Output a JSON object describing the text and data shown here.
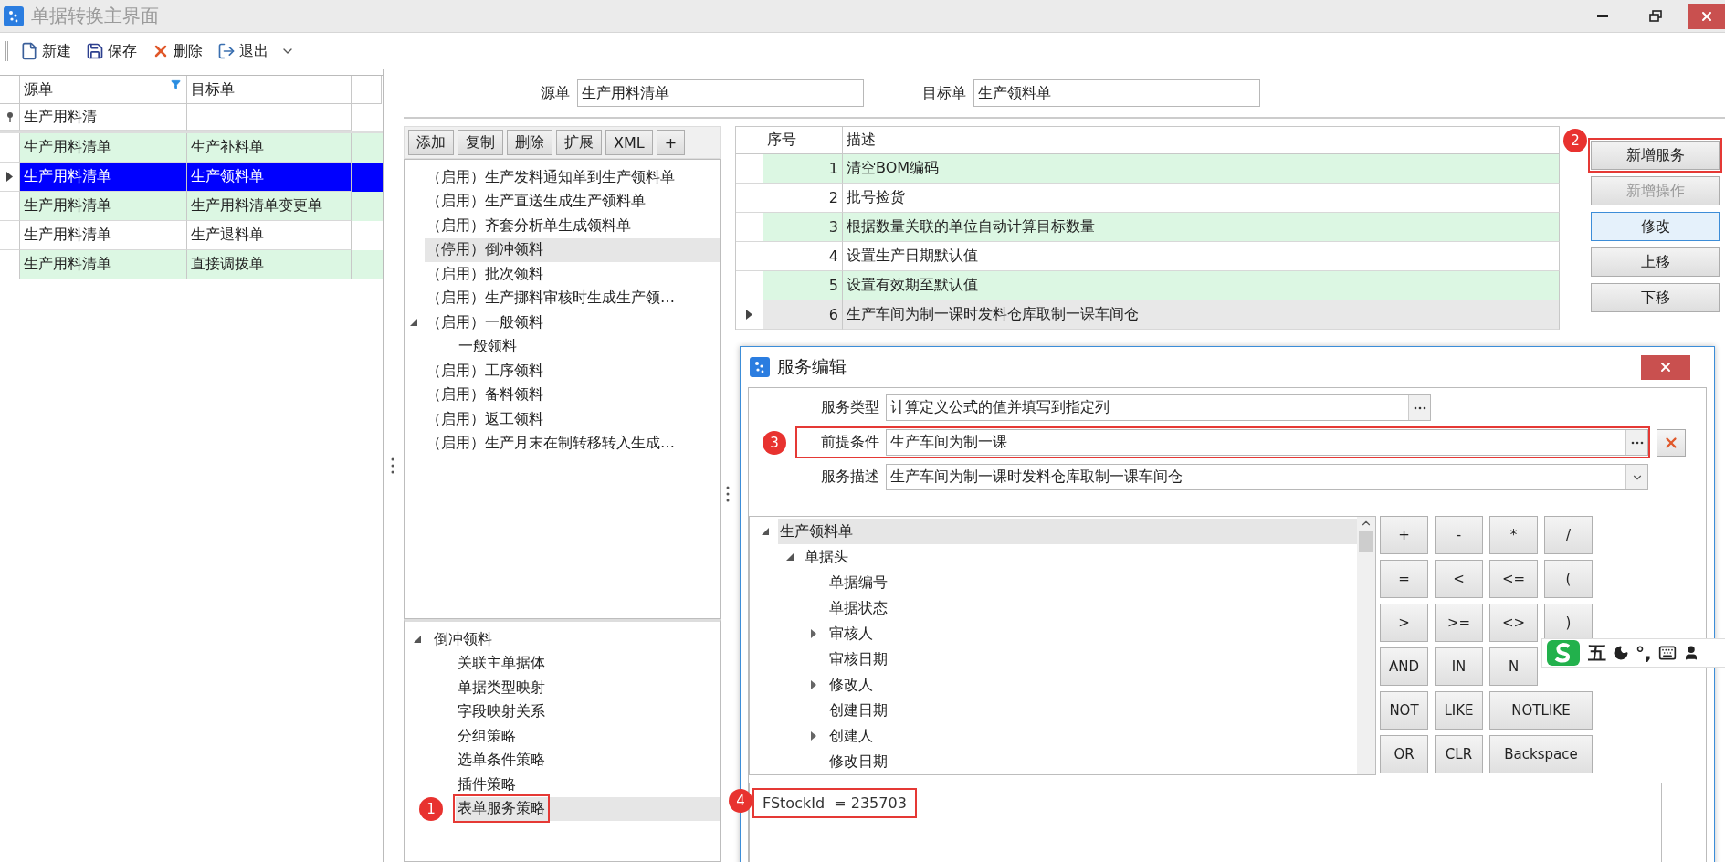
{
  "window": {
    "title": "单据转换主界面"
  },
  "toolbar": [
    {
      "label": "新建",
      "kind": "new"
    },
    {
      "label": "保存",
      "kind": "save"
    },
    {
      "label": "删除",
      "kind": "delete"
    },
    {
      "label": "退出",
      "kind": "exit"
    }
  ],
  "mapping_grid": {
    "columns": [
      "源单",
      "目标单"
    ],
    "filter": "生产用料清",
    "rows": [
      {
        "source": "生产用料清单",
        "target": "生产补料单",
        "selected": false
      },
      {
        "source": "生产用料清单",
        "target": "生产领料单",
        "selected": true
      },
      {
        "source": "生产用料清单",
        "target": "生产用料清单变更单",
        "selected": false
      },
      {
        "source": "生产用料清单",
        "target": "生产退料单",
        "selected": false
      },
      {
        "source": "生产用料清单",
        "target": "直接调拨单",
        "selected": false
      }
    ]
  },
  "header_fields": [
    {
      "label": "源单",
      "value": "生产用料清单"
    },
    {
      "label": "目标单",
      "value": "生产领料单"
    }
  ],
  "policy_buttons": [
    "添加",
    "复制",
    "删除",
    "扩展",
    "XML",
    "+"
  ],
  "policies": [
    {
      "label": "（启用）生产发料通知单到生产领料单",
      "selected": false
    },
    {
      "label": "（启用）生产直送生成生产领料单",
      "selected": false
    },
    {
      "label": "（启用）齐套分析单生成领料单",
      "selected": false
    },
    {
      "label": "（停用）倒冲领料",
      "selected": true
    },
    {
      "label": "（启用）批次领料",
      "selected": false
    },
    {
      "label": "（启用）生产挪料审核时生成生产领…",
      "selected": false
    },
    {
      "label": "（启用）一般领料",
      "selected": false,
      "expanded": true,
      "children": [
        {
          "label": "一般领料",
          "selected": false
        }
      ]
    },
    {
      "label": "（启用）工序领料",
      "selected": false
    },
    {
      "label": "（启用）备料领料",
      "selected": false
    },
    {
      "label": "（启用）返工领料",
      "selected": false
    },
    {
      "label": "（启用）生产月末在制转移转入生成…",
      "selected": false
    }
  ],
  "policy_tree": [
    {
      "label": "倒冲领料",
      "selected": false,
      "expanded": true,
      "children": [
        {
          "label": "关联主单据体",
          "selected": false
        },
        {
          "label": "单据类型映射",
          "selected": false
        },
        {
          "label": "字段映射关系",
          "selected": false
        },
        {
          "label": "分组策略",
          "selected": false
        },
        {
          "label": "选单条件策略",
          "selected": false
        },
        {
          "label": "插件策略",
          "selected": false
        },
        {
          "label": "表单服务策略",
          "selected": true,
          "annotation": "1"
        }
      ]
    }
  ],
  "services_table": {
    "columns": [
      "序号",
      "描述"
    ],
    "rows": [
      {
        "no": "1",
        "description": "清空BOM编码",
        "selected": false
      },
      {
        "no": "2",
        "description": "批号捡货",
        "selected": false
      },
      {
        "no": "3",
        "description": "根据数量关联的单位自动计算目标数量",
        "selected": false
      },
      {
        "no": "4",
        "description": "设置生产日期默认值",
        "selected": false
      },
      {
        "no": "5",
        "description": "设置有效期至默认值",
        "selected": false
      },
      {
        "no": "6",
        "description": "生产车间为制一课时发料仓库取制一课车间仓",
        "selected": true
      }
    ]
  },
  "service_buttons": [
    {
      "label": "新增服务",
      "disabled": false,
      "focused": false,
      "annotation": "2"
    },
    {
      "label": "新增操作",
      "disabled": true,
      "focused": false
    },
    {
      "label": "修改",
      "disabled": false,
      "focused": true
    },
    {
      "label": "上移",
      "disabled": false,
      "focused": false
    },
    {
      "label": "下移",
      "disabled": false,
      "focused": false
    }
  ],
  "dialog": {
    "title": "服务编辑",
    "fields": [
      {
        "label": "服务类型",
        "value": "计算定义公式的值并填写到指定列",
        "kind": "lookup"
      },
      {
        "label": "前提条件",
        "value": "生产车间为制一课",
        "kind": "lookup_clear",
        "annotation": "3"
      },
      {
        "label": "服务描述",
        "value": "生产车间为制一课时发料仓库取制一课车间仓",
        "kind": "dropdown"
      }
    ],
    "field_tree": [
      {
        "label": "生产领料单",
        "selected": true,
        "expanded": true,
        "children": [
          {
            "label": "单据头",
            "selected": false,
            "expanded": true,
            "children": [
              {
                "label": "单据编号",
                "selected": false
              },
              {
                "label": "单据状态",
                "selected": false
              },
              {
                "label": "审核人",
                "selected": false,
                "expanded": false
              },
              {
                "label": "审核日期",
                "selected": false
              },
              {
                "label": "修改人",
                "selected": false,
                "expanded": false
              },
              {
                "label": "创建日期",
                "selected": false
              },
              {
                "label": "创建人",
                "selected": false,
                "expanded": false
              },
              {
                "label": "修改日期",
                "selected": false
              }
            ]
          }
        ]
      }
    ],
    "operator_rows": [
      [
        {
          "label": "+"
        },
        {
          "label": "-"
        },
        {
          "label": "*"
        },
        {
          "label": "/"
        }
      ],
      [
        {
          "label": "="
        },
        {
          "label": "<"
        },
        {
          "label": "<="
        },
        {
          "label": "("
        }
      ],
      [
        {
          "label": ">"
        },
        {
          "label": ">="
        },
        {
          "label": "<>"
        },
        {
          "label": ")"
        }
      ],
      [
        {
          "label": "AND"
        },
        {
          "label": "IN"
        },
        {
          "label": "N"
        }
      ],
      [
        {
          "label": "NOT"
        },
        {
          "label": "LIKE"
        },
        {
          "label": "NOTLIKE",
          "wide": true
        }
      ],
      [
        {
          "label": "OR"
        },
        {
          "label": "CLR"
        },
        {
          "label": "Backspace",
          "wide": true
        }
      ]
    ],
    "formula": {
      "value": "FStockId  = 235703",
      "annotation": "4"
    }
  },
  "ime_toolbar": {
    "mode": "五",
    "punctuation": "°,"
  }
}
